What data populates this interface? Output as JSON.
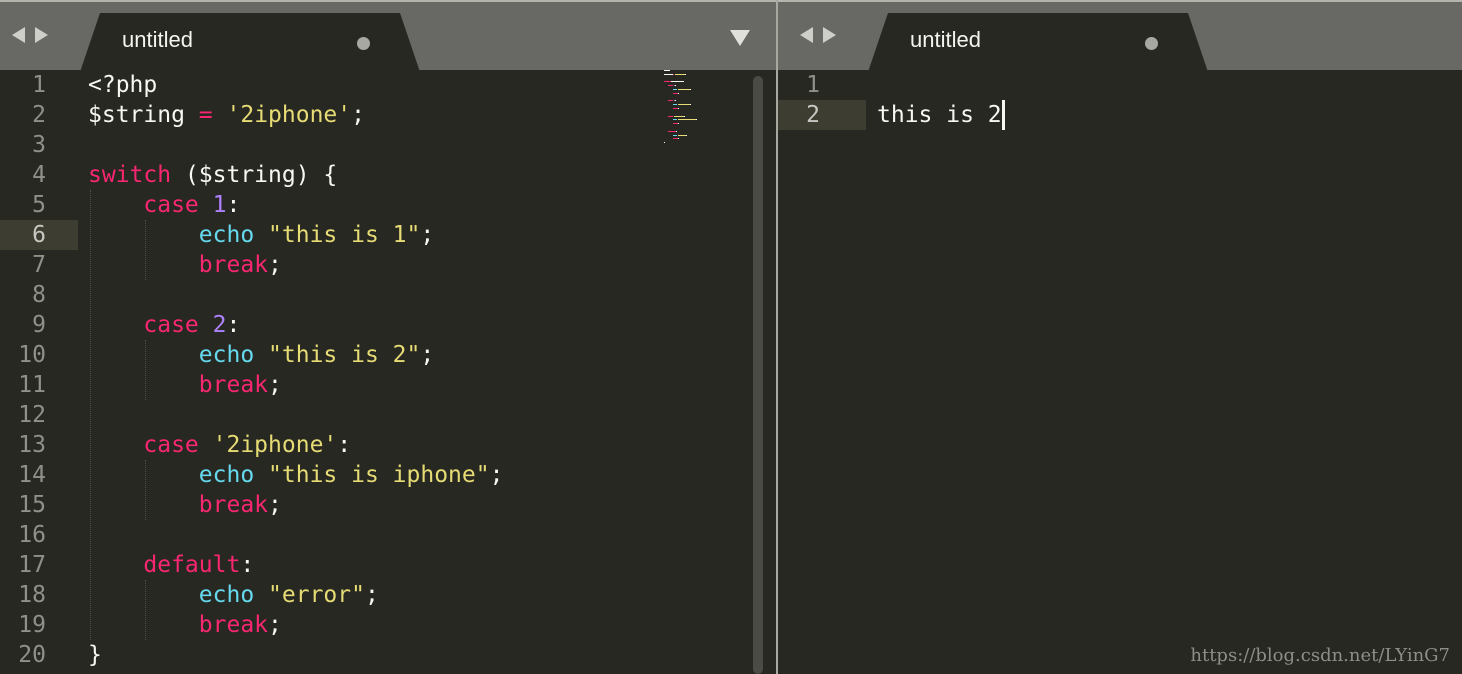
{
  "left_pane": {
    "tab": {
      "title": "untitled"
    },
    "nav_back": "back",
    "nav_forward": "forward",
    "line_numbers": [
      "1",
      "2",
      "3",
      "4",
      "5",
      "6",
      "7",
      "8",
      "9",
      "10",
      "11",
      "12",
      "13",
      "14",
      "15",
      "16",
      "17",
      "18",
      "19",
      "20"
    ],
    "current_line": 6,
    "code_lines": [
      [
        {
          "t": "<?php",
          "c": "plain"
        }
      ],
      [
        {
          "t": "$string ",
          "c": "plain"
        },
        {
          "t": "=",
          "c": "kw"
        },
        {
          "t": " ",
          "c": "plain"
        },
        {
          "t": "'2iphone'",
          "c": "str"
        },
        {
          "t": ";",
          "c": "plain"
        }
      ],
      [],
      [
        {
          "t": "switch",
          "c": "kw"
        },
        {
          "t": " ($string) {",
          "c": "plain"
        }
      ],
      [
        {
          "t": "    ",
          "c": "plain"
        },
        {
          "t": "case",
          "c": "kw"
        },
        {
          "t": " ",
          "c": "plain"
        },
        {
          "t": "1",
          "c": "num"
        },
        {
          "t": ":",
          "c": "plain"
        }
      ],
      [
        {
          "t": "        ",
          "c": "plain"
        },
        {
          "t": "echo",
          "c": "fn"
        },
        {
          "t": " ",
          "c": "plain"
        },
        {
          "t": "\"this is 1\"",
          "c": "str"
        },
        {
          "t": ";",
          "c": "plain"
        }
      ],
      [
        {
          "t": "        ",
          "c": "plain"
        },
        {
          "t": "break",
          "c": "kw"
        },
        {
          "t": ";",
          "c": "plain"
        }
      ],
      [],
      [
        {
          "t": "    ",
          "c": "plain"
        },
        {
          "t": "case",
          "c": "kw"
        },
        {
          "t": " ",
          "c": "plain"
        },
        {
          "t": "2",
          "c": "num"
        },
        {
          "t": ":",
          "c": "plain"
        }
      ],
      [
        {
          "t": "        ",
          "c": "plain"
        },
        {
          "t": "echo",
          "c": "fn"
        },
        {
          "t": " ",
          "c": "plain"
        },
        {
          "t": "\"this is 2\"",
          "c": "str"
        },
        {
          "t": ";",
          "c": "plain"
        }
      ],
      [
        {
          "t": "        ",
          "c": "plain"
        },
        {
          "t": "break",
          "c": "kw"
        },
        {
          "t": ";",
          "c": "plain"
        }
      ],
      [],
      [
        {
          "t": "    ",
          "c": "plain"
        },
        {
          "t": "case",
          "c": "kw"
        },
        {
          "t": " ",
          "c": "plain"
        },
        {
          "t": "'2iphone'",
          "c": "str"
        },
        {
          "t": ":",
          "c": "plain"
        }
      ],
      [
        {
          "t": "        ",
          "c": "plain"
        },
        {
          "t": "echo",
          "c": "fn"
        },
        {
          "t": " ",
          "c": "plain"
        },
        {
          "t": "\"this is iphone\"",
          "c": "str"
        },
        {
          "t": ";",
          "c": "plain"
        }
      ],
      [
        {
          "t": "        ",
          "c": "plain"
        },
        {
          "t": "break",
          "c": "kw"
        },
        {
          "t": ";",
          "c": "plain"
        }
      ],
      [],
      [
        {
          "t": "    ",
          "c": "plain"
        },
        {
          "t": "default",
          "c": "kw"
        },
        {
          "t": ":",
          "c": "plain"
        }
      ],
      [
        {
          "t": "        ",
          "c": "plain"
        },
        {
          "t": "echo",
          "c": "fn"
        },
        {
          "t": " ",
          "c": "plain"
        },
        {
          "t": "\"error\"",
          "c": "str"
        },
        {
          "t": ";",
          "c": "plain"
        }
      ],
      [
        {
          "t": "        ",
          "c": "plain"
        },
        {
          "t": "break",
          "c": "kw"
        },
        {
          "t": ";",
          "c": "plain"
        }
      ],
      [
        {
          "t": "}",
          "c": "plain"
        }
      ]
    ]
  },
  "right_pane": {
    "tab": {
      "title": "untitled"
    },
    "nav_back": "back",
    "nav_forward": "forward",
    "line_numbers": [
      "1",
      "2"
    ],
    "current_line": 2,
    "output_lines": [
      "",
      "this is 2"
    ]
  },
  "watermark": "https://blog.csdn.net/LYinG7",
  "colors": {
    "background": "#272822",
    "tabbar": "#686864",
    "keyword": "#f92672",
    "function": "#66d9ef",
    "string": "#e6db74",
    "number": "#ae81ff",
    "plain": "#f8f8f2",
    "line_number": "#90908a"
  }
}
